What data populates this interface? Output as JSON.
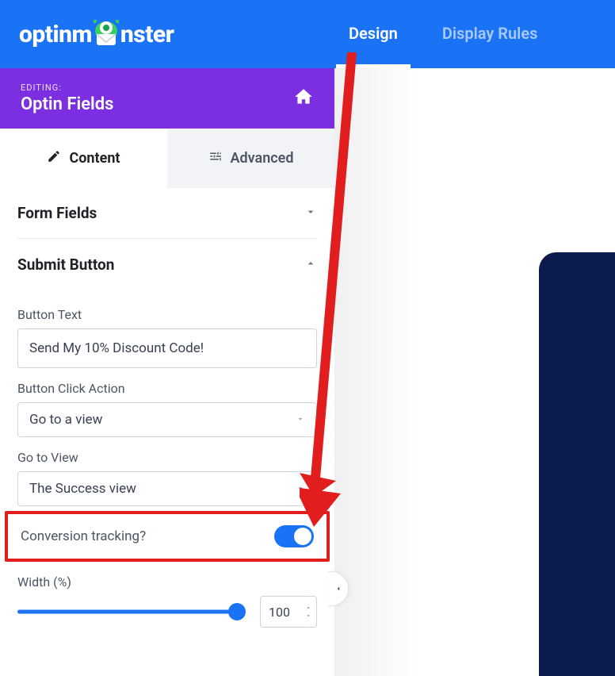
{
  "header": {
    "logo_pre": "optinm",
    "logo_post": "nster",
    "nav": {
      "design": "Design",
      "display_rules": "Display Rules"
    }
  },
  "editing": {
    "label": "EDITING:",
    "title": "Optin Fields"
  },
  "tabs": {
    "content": "Content",
    "advanced": "Advanced"
  },
  "accordions": {
    "form_fields": "Form Fields",
    "submit_button": "Submit Button"
  },
  "submit": {
    "button_text_label": "Button Text",
    "button_text_value": "Send My 10% Discount Code!",
    "click_action_label": "Button Click Action",
    "click_action_value": "Go to a view",
    "go_to_view_label": "Go to View",
    "go_to_view_value": "The Success view",
    "conversion_label": "Conversion tracking?",
    "conversion_on": true,
    "width_label": "Width (%)",
    "width_value": "100"
  },
  "colors": {
    "brand_blue": "#1a73f5",
    "purple": "#7b2fe0",
    "annotation_red": "#e11d1d",
    "dark_panel": "#0b1b4d"
  }
}
